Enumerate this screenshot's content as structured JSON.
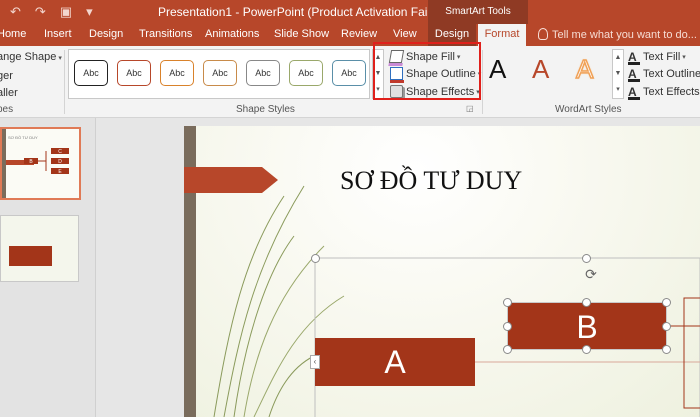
{
  "titlebar": {
    "title": "Presentation1 - PowerPoint (Product Activation Failed)",
    "context_tab_group": "SmartArt Tools",
    "qat_icons": [
      "undo-icon",
      "redo-icon",
      "present-icon",
      "customize-qat-icon"
    ]
  },
  "tabs": {
    "home": "Home",
    "insert": "Insert",
    "design": "Design",
    "transitions": "Transitions",
    "animations": "Animations",
    "slideshow": "Slide Show",
    "review": "Review",
    "view": "View",
    "smartart_design": "Design",
    "format": "Format",
    "tell_me": "Tell me what you want to do..."
  },
  "ribbon": {
    "change_shape": "ange Shape",
    "larger": "ger",
    "smaller": "aller",
    "shapes_group": "pes",
    "style_sample": "Abc",
    "shape_styles_group": "Shape Styles",
    "shape_fill": "Shape Fill",
    "shape_outline": "Shape Outline",
    "shape_effects": "Shape Effects",
    "wordart_sample": "A",
    "text_fill": "Text Fill",
    "text_outline": "Text Outline",
    "text_effects": "Text Effects",
    "wordart_group": "WordArt Styles",
    "shape_style_colors": [
      "#222222",
      "#b7472a",
      "#d9822b",
      "#c88b4a",
      "#888888",
      "#9aa86b",
      "#5a8fa8"
    ]
  },
  "thumbnails": {
    "slide1_title": "SƠ ĐỒ TƯ DUY",
    "slide1_nodes": [
      "B",
      "C",
      "D",
      "E"
    ]
  },
  "slide": {
    "title": "SƠ ĐỒ TƯ DUY",
    "node_a": "A",
    "node_b": "B"
  },
  "colors": {
    "accent": "#b7472a",
    "node_fill": "#a33519",
    "highlight_box": "#e0201b"
  }
}
